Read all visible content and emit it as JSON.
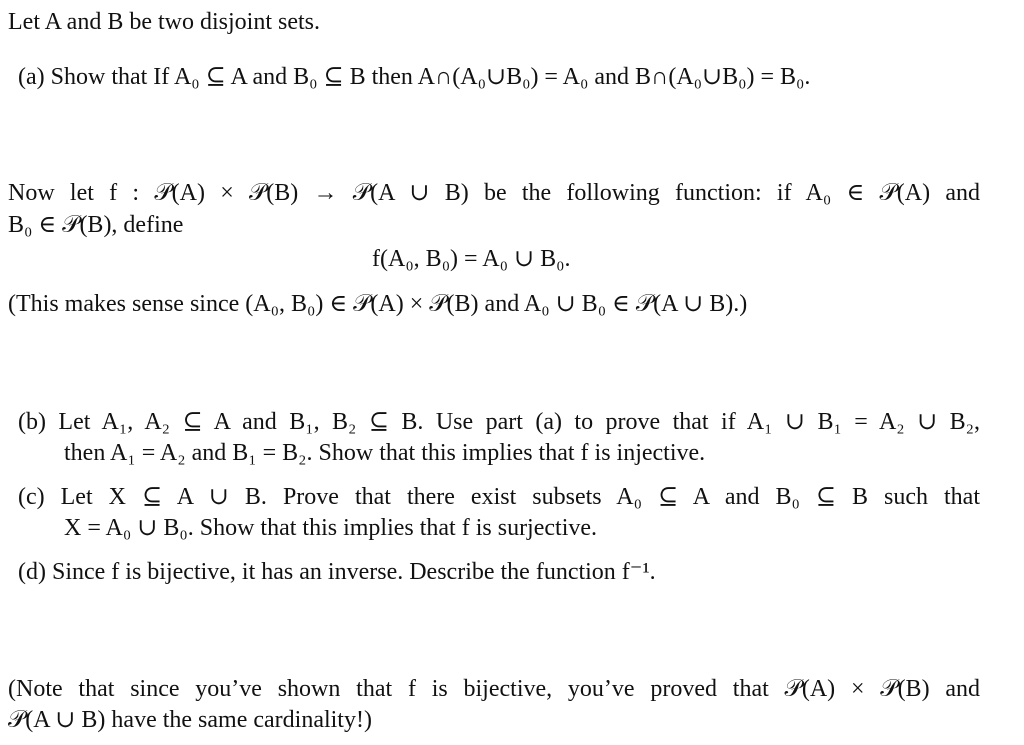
{
  "intro": "Let A and B be two disjoint sets.",
  "part_a": "(a) Show that If A₀ ⊆ A and B₀ ⊆ B then A∩(A₀∪B₀) = A₀ and B∩(A₀∪B₀) = B₀.",
  "definition": {
    "line1": "Now let f : 𝒫(A) × 𝒫(B) → 𝒫(A ∪ B) be the following function: if A₀ ∈ 𝒫(A) and",
    "line2": "B₀ ∈ 𝒫(B), define",
    "formula": "f(A₀, B₀) = A₀ ∪ B₀.",
    "remark": "(This makes sense since (A₀, B₀) ∈ 𝒫(A) × 𝒫(B) and A₀ ∪ B₀ ∈ 𝒫(A ∪ B).)"
  },
  "part_b": {
    "line1": "(b) Let A₁, A₂ ⊆ A and B₁, B₂ ⊆ B. Use part (a) to prove that if A₁ ∪ B₁ = A₂ ∪ B₂,",
    "line2": "then A₁ = A₂ and B₁ = B₂. Show that this implies that f is injective."
  },
  "part_c": {
    "line1": "(c) Let X ⊆ A ∪ B. Prove that there exist subsets A₀ ⊆ A and B₀ ⊆ B such that",
    "line2": "X = A₀ ∪ B₀. Show that this implies that f is surjective."
  },
  "part_d": "(d) Since f is bijective, it has an inverse. Describe the function f⁻¹.",
  "note": {
    "line1": "(Note that since you’ve shown that f is bijective, you’ve proved that 𝒫(A) × 𝒫(B) and",
    "line2": "𝒫(A ∪ B) have the same cardinality!)"
  }
}
